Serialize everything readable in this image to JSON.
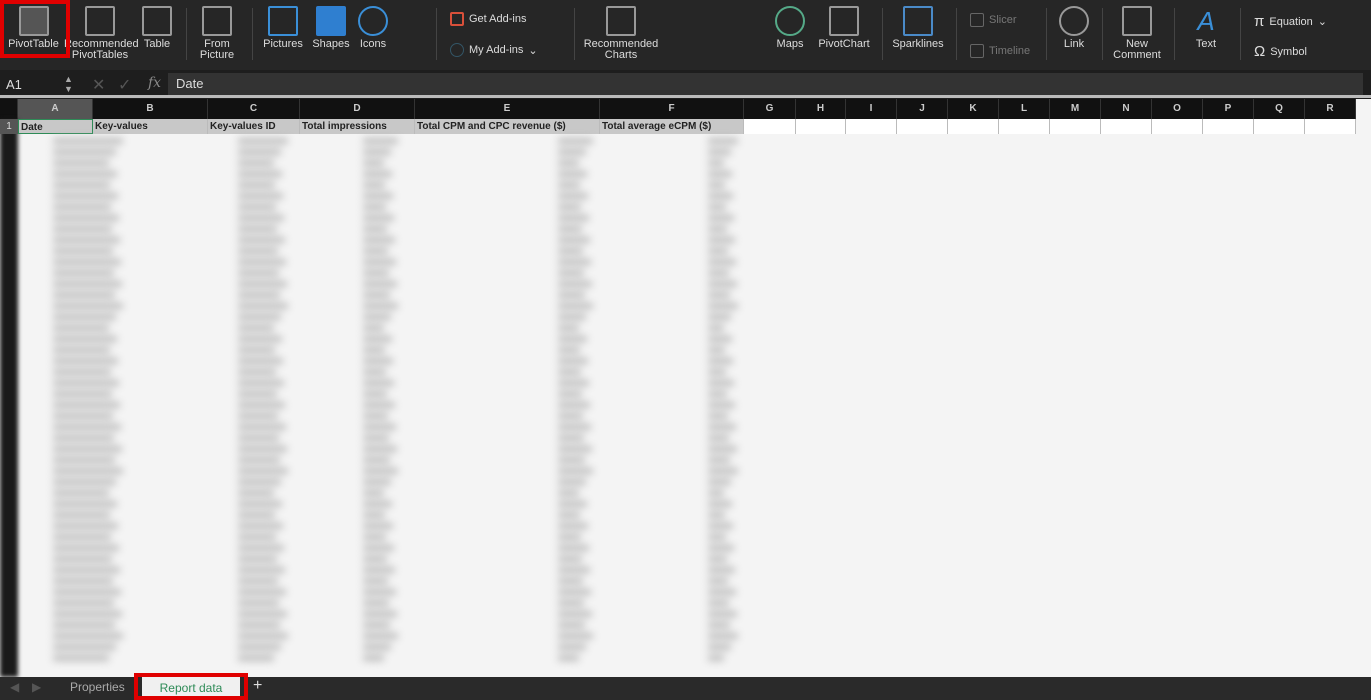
{
  "ribbon": {
    "pivot_table": "PivotTable",
    "recommended_pivot": "Recommended PivotTables",
    "table": "Table",
    "from_picture": "From Picture",
    "pictures": "Pictures",
    "shapes": "Shapes",
    "icons": "Icons",
    "get_addins": "Get Add-ins",
    "my_addins": "My Add-ins",
    "recommended_charts": "Recommended Charts",
    "maps": "Maps",
    "pivot_chart": "PivotChart",
    "sparklines": "Sparklines",
    "slicer": "Slicer",
    "timeline": "Timeline",
    "link": "Link",
    "new_comment": "New Comment",
    "text": "Text",
    "equation": "Equation",
    "symbol": "Symbol"
  },
  "formula_bar": {
    "name_box": "A1",
    "fx": "fx",
    "value": "Date"
  },
  "columns": [
    "A",
    "B",
    "C",
    "D",
    "E",
    "F",
    "G",
    "H",
    "I",
    "J",
    "K",
    "L",
    "M",
    "N",
    "O",
    "P",
    "Q",
    "R"
  ],
  "row_number": "1",
  "headers": [
    "Date",
    "Key-values",
    "Key-values ID",
    "Total impressions",
    "Total CPM and CPC revenue ($)",
    "Total average eCPM ($)"
  ],
  "sheets": {
    "tab1": "Properties",
    "tab2": "Report data",
    "add": "+"
  },
  "colors": {
    "highlight": "#e00000",
    "active_tab_text": "#2e8b57"
  }
}
